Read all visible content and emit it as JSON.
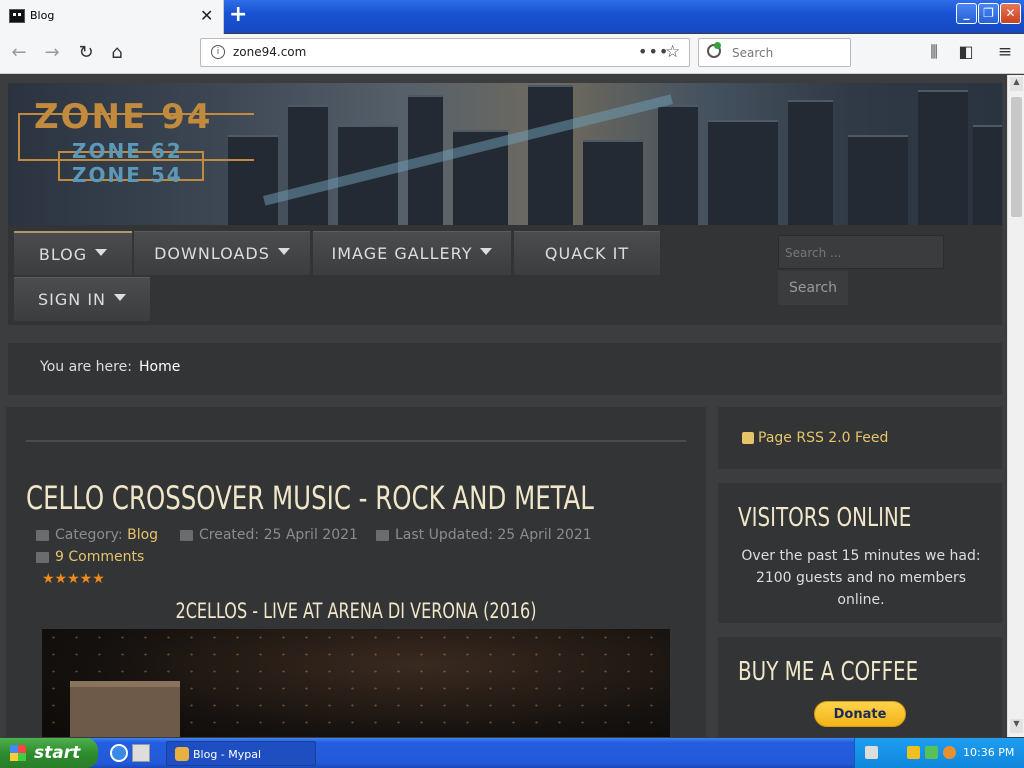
{
  "browser": {
    "tab_title": "Blog",
    "url": "zone94.com",
    "search_placeholder": "Search",
    "new_tab_symbol": "+"
  },
  "site": {
    "logo_main": "ZONE 94",
    "logo_sub1": "ZONE 62",
    "logo_sub2": "ZONE 54",
    "menu": [
      {
        "label": "BLOG",
        "has_dropdown": true,
        "active": true
      },
      {
        "label": "DOWNLOADS",
        "has_dropdown": true
      },
      {
        "label": "IMAGE GALLERY",
        "has_dropdown": true
      },
      {
        "label": "QUACK IT",
        "has_dropdown": false
      },
      {
        "label": "SIGN IN",
        "has_dropdown": true
      }
    ],
    "search_placeholder": "Search ...",
    "search_button": "Search",
    "breadcrumb_label": "You are here:",
    "breadcrumb_home": "Home"
  },
  "article": {
    "title": "CELLO CROSSOVER MUSIC - ROCK AND METAL",
    "category_label": "Category:",
    "category": "Blog",
    "created": "Created: 25 April 2021",
    "updated": "Last Updated: 25 April 2021",
    "comments": "9 Comments",
    "rating_stars": 5,
    "stars_text": "★★★★★",
    "subtitle": "2CELLOS - LIVE AT ARENA DI VERONA (2016)"
  },
  "sidebar": {
    "rss": "Page RSS 2.0 Feed",
    "visitors_heading": "VISITORS ONLINE",
    "visitors_text": "Over the past 15 minutes we had: 2100 guests and no members online.",
    "coffee_heading": "BUY ME A COFFEE",
    "donate": "Donate"
  },
  "taskbar": {
    "start": "start",
    "task_item": "Blog - Mypal",
    "clock": "10:36 PM"
  },
  "colors": {
    "accent_gold": "#e6c46a",
    "heading_cream": "#f0e6c8",
    "star_orange": "#f08a1a",
    "xp_blue": "#245ee0"
  }
}
